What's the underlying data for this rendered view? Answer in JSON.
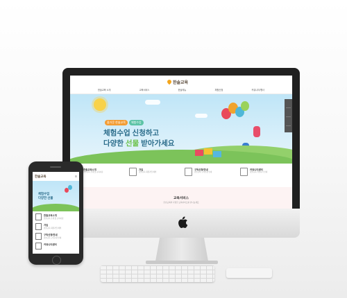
{
  "site": {
    "logo": "한솔교육",
    "nav": [
      "한솔교육 소개",
      "교육서비스",
      "한솔매뉴",
      "체험신청",
      "커뮤니티/행사"
    ],
    "hero": {
      "badge1": "즐거운 한솔교육",
      "badge2": "체험수업",
      "line1": "체험수업 신청하고",
      "line2_pre": "다양한 ",
      "line2_highlight": "선물",
      "line2_post": " 받아가세요"
    },
    "features": [
      {
        "title": "한솔교육소개",
        "desc": "한솔교육 소개 및 교육이념"
      },
      {
        "title": "가입",
        "desc": "한솔교육 회원가입 혜택"
      },
      {
        "title": "구독신청/안내",
        "desc": "한솔교육 구독신청 안내"
      },
      {
        "title": "커뮤니티센터",
        "desc": "한솔교육 커뮤니티 안내"
      }
    ],
    "section": {
      "title": "교육서비스",
      "subtitle": "한솔교육의 다양한 교육서비스를 만나보세요"
    }
  },
  "mobile": {
    "logo": "한솔교육",
    "menu_icon": "≡",
    "hero_text_1": "체험수업",
    "hero_text_2": "다양한 선물",
    "items": [
      {
        "title": "한솔교육소개",
        "desc": "한솔교육 소개 및 교육이념"
      },
      {
        "title": "가입",
        "desc": "한솔교육 회원가입 혜택"
      },
      {
        "title": "구독신청/안내",
        "desc": "한솔교육 구독신청 안내"
      },
      {
        "title": "커뮤니티센터",
        "desc": ""
      }
    ]
  },
  "colors": {
    "accent": "#f39c33",
    "sky": "#bfe5f7",
    "grass": "#7cc35a",
    "heading": "#2b6c8a"
  },
  "icons": [
    "apple-logo-icon",
    "menu-icon",
    "document-icon"
  ]
}
